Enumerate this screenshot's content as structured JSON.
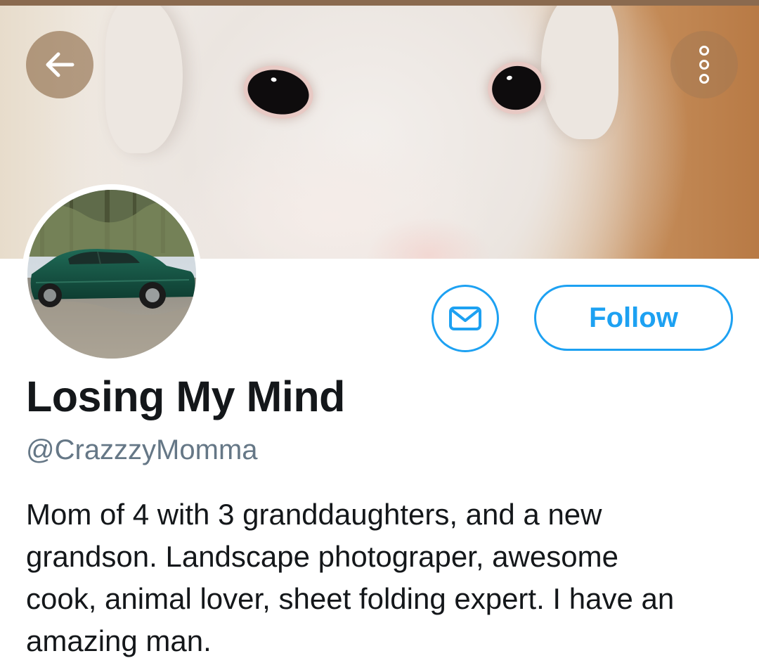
{
  "header": {
    "back_icon": "arrow-left-icon",
    "more_icon": "more-vertical-icon",
    "banner_description_icon": "banner-photo",
    "colors": {
      "overlay": "#8c6946",
      "accent": "#1da1f2"
    }
  },
  "profile": {
    "display_name": "Losing My Mind",
    "handle": "@CrazzzyMomma",
    "bio_lines": [
      "Mom of 4 with 3 granddaughters, and a new",
      "grandson. Landscape photograper, awesome",
      "cook, animal lover, sheet folding expert. I have an",
      "amazing man."
    ]
  },
  "actions": {
    "message_icon": "envelope-icon",
    "follow_label": "Follow"
  },
  "colors": {
    "accent": "#1da1f2",
    "text_primary": "#14171a",
    "text_secondary": "#657786"
  }
}
